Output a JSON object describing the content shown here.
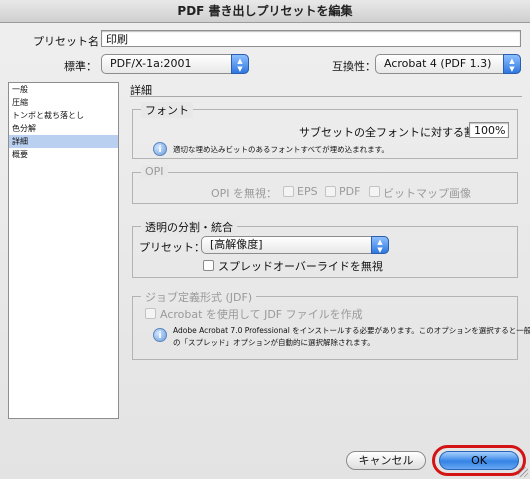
{
  "window": {
    "title": "PDF 書き出しプリセットを編集"
  },
  "preset": {
    "label": "プリセット名：",
    "value": "印刷"
  },
  "standard": {
    "label": "標準：",
    "value": "PDF/X-1a:2001"
  },
  "compat": {
    "label": "互換性：",
    "value": "Acrobat 4 (PDF 1.3)"
  },
  "sidebar": {
    "items": [
      {
        "label": "一般",
        "selected": false
      },
      {
        "label": "圧縮",
        "selected": false
      },
      {
        "label": "トンボと裁ち落とし",
        "selected": false
      },
      {
        "label": "色分解",
        "selected": false
      },
      {
        "label": "詳細",
        "selected": true
      },
      {
        "label": "概要",
        "selected": false
      }
    ]
  },
  "panel": {
    "title": "詳細",
    "fonts": {
      "legend": "フォント",
      "subset_label": "サブセットの全フォントに対する割合：",
      "subset_value": "100%",
      "note": "適切な埋め込みビットのあるフォントすべてが埋め込まれます。"
    },
    "opi": {
      "legend": "OPI",
      "omit_label": "OPI を無視：",
      "eps": "EPS",
      "pdf": "PDF",
      "bitmap": "ビットマップ画像"
    },
    "flatten": {
      "legend": "透明の分割・統合",
      "preset_label": "プリセット：",
      "preset_value": "[高解像度]",
      "ignore_spread": "スプレッドオーバーライドを無視"
    },
    "jdf": {
      "legend": "ジョブ定義形式 (JDF)",
      "create_label": "Acrobat を使用して JDF ファイルを作成",
      "note_line1": "Adobe Acrobat 7.0 Professional をインストールする必要があります。このオプションを選択すると一般パネル",
      "note_line2": "の「スプレッド」オプションが自動的に選択解除されます。"
    }
  },
  "footer": {
    "cancel": "キャンセル",
    "ok": "OK"
  },
  "colors": {
    "accent": "#3483e5",
    "highlight": "#d41414"
  }
}
